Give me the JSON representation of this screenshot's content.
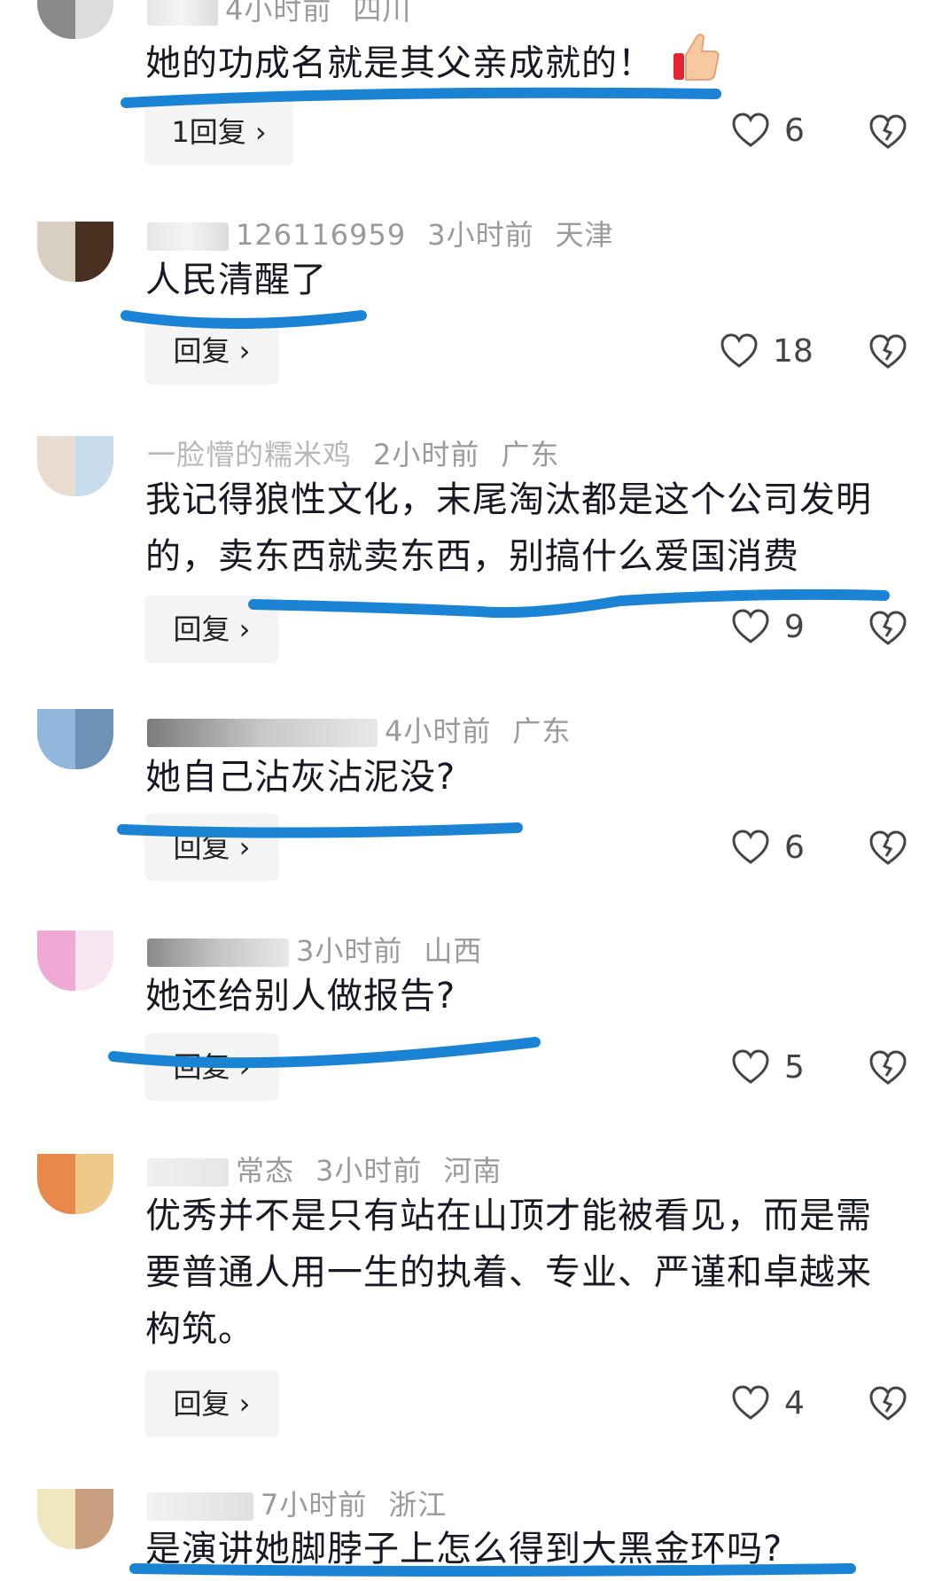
{
  "accent_underline_color": "#1a83d4",
  "comments": [
    {
      "meta_name": "",
      "meta_time": "4小时前",
      "meta_region": "四川",
      "text": "她的功成名就是其父亲成就的！",
      "reply_label": "1回复 ›",
      "likes": "6",
      "emoji": "thumbs-up"
    },
    {
      "meta_name": "126116959",
      "meta_time": "3小时前",
      "meta_region": "天津",
      "text": "人民清醒了",
      "reply_label": "回复 ›",
      "likes": "18"
    },
    {
      "meta_name": "一脸懵的糯米鸡",
      "meta_time": "2小时前",
      "meta_region": "广东",
      "text": "我记得狼性文化，末尾淘汰都是这个公司发明的，卖东西就卖东西，别搞什么爱国消费",
      "reply_label": "回复 ›",
      "likes": "9"
    },
    {
      "meta_name": "",
      "meta_time": "4小时前",
      "meta_region": "广东",
      "text": "她自己沾灰沾泥没?",
      "reply_label": "回复 ›",
      "likes": "6"
    },
    {
      "meta_name": "",
      "meta_time": "3小时前",
      "meta_region": "山西",
      "text": "她还给别人做报告?",
      "reply_label": "回复 ›",
      "likes": "5"
    },
    {
      "meta_name": "常态",
      "meta_time": "3小时前",
      "meta_region": "河南",
      "text": "优秀并不是只有站在山顶才能被看见，而是需要普通人用一生的执着、专业、严谨和卓越来构筑。",
      "reply_label": "回复 ›",
      "likes": "4"
    },
    {
      "meta_name": "",
      "meta_time": "7小时前",
      "meta_region": "浙江",
      "text": "是演讲她脚脖子上怎么得到大黑金环吗?",
      "reply_label": "",
      "likes": ""
    }
  ]
}
